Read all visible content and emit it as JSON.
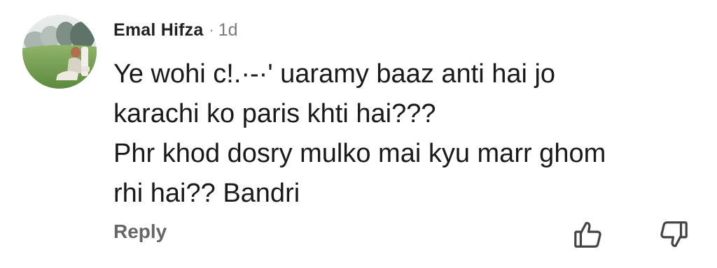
{
  "comment": {
    "author": "Emal Hifza",
    "separator": "·",
    "time": "1d",
    "body_lines": [
      "Ye wohi c!.·-·' uaramy baaz anti hai jo",
      "karachi ko paris khti hai???",
      "Phr khod dosry mulko mai kyu marr ghom",
      "rhi hai?? Bandri"
    ],
    "reply_label": "Reply",
    "like_icon": "thumbs-up-icon",
    "dislike_icon": "thumbs-down-icon"
  },
  "colors": {
    "author": "#222222",
    "meta": "#7a7a7a",
    "body": "#1a1a1a",
    "reply": "#666666",
    "icon": "#444444"
  }
}
